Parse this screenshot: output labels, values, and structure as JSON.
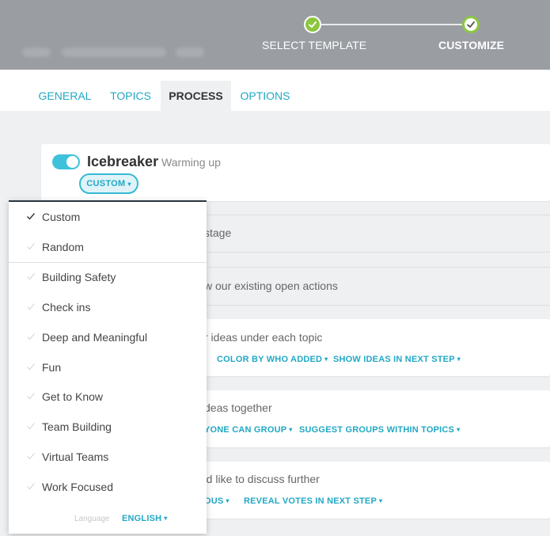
{
  "stepper": {
    "steps": [
      {
        "label": "SELECT TEMPLATE",
        "state": "done"
      },
      {
        "label": "CUSTOMIZE",
        "state": "current"
      }
    ]
  },
  "tabs": [
    {
      "label": "GENERAL",
      "active": false
    },
    {
      "label": "TOPICS",
      "active": false
    },
    {
      "label": "PROCESS",
      "active": true
    },
    {
      "label": "OPTIONS",
      "active": false
    }
  ],
  "icebreaker": {
    "enabled": true,
    "title": "Icebreaker",
    "subtitle": "Warming up",
    "mode_label": "CUSTOM"
  },
  "rows": [
    {
      "text": "stage"
    },
    {
      "text": "w our existing open actions"
    },
    {
      "text": "r ideas under each topic",
      "links": [
        "COLOR BY WHO ADDED",
        "SHOW IDEAS IN NEXT STEP"
      ]
    },
    {
      "text": "deas together",
      "links": [
        "YONE CAN GROUP",
        "SUGGEST GROUPS WITHIN TOPICS"
      ]
    },
    {
      "text": "'d like to discuss further",
      "links": [
        "OUS",
        "REVEAL VOTES IN NEXT STEP"
      ]
    }
  ],
  "dropdown": {
    "items": [
      {
        "label": "Custom",
        "selected": true
      },
      {
        "label": "Random",
        "selected": false
      },
      {
        "label": "Building Safety",
        "selected": false
      },
      {
        "label": "Check ins",
        "selected": false
      },
      {
        "label": "Deep and Meaningful",
        "selected": false
      },
      {
        "label": "Fun",
        "selected": false
      },
      {
        "label": "Get to Know",
        "selected": false
      },
      {
        "label": "Team Building",
        "selected": false
      },
      {
        "label": "Virtual Teams",
        "selected": false
      },
      {
        "label": "Work Focused",
        "selected": false
      }
    ],
    "language_label": "Language",
    "language_value": "ENGLISH"
  },
  "colors": {
    "accent": "#21a8c4",
    "step_done": "#8cc63f",
    "header_bg": "#9a9ea3",
    "toggle_on": "#3ec2da"
  }
}
